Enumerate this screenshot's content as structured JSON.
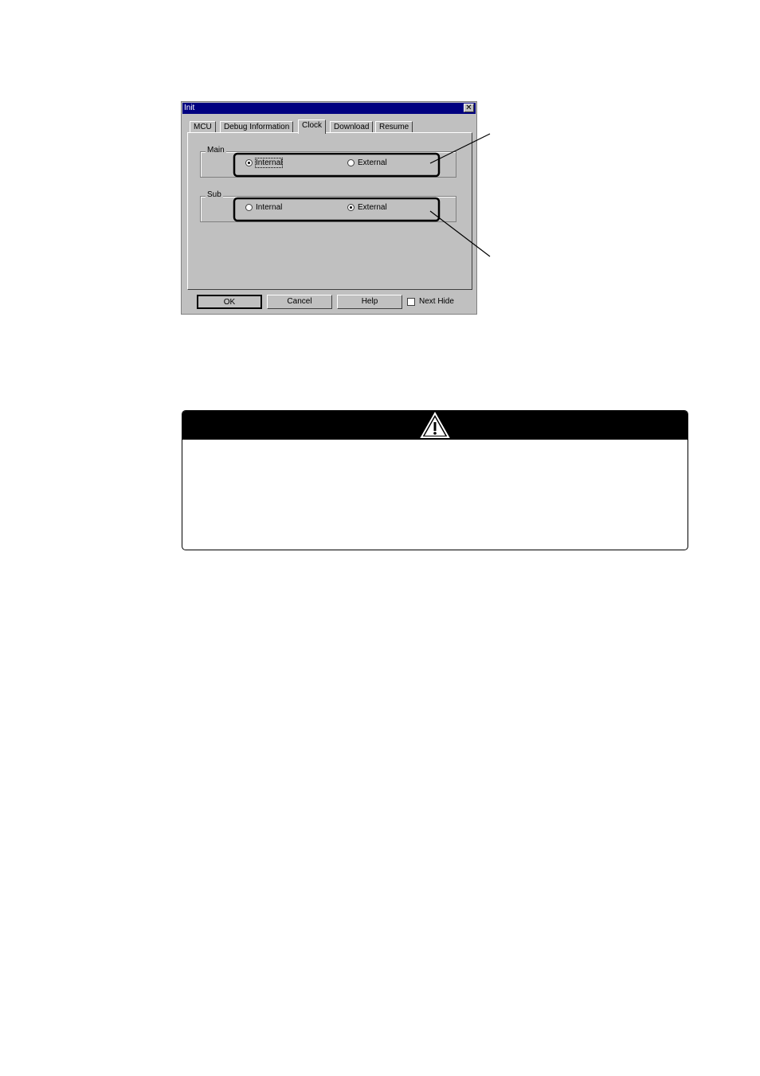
{
  "dialog": {
    "title": "Init",
    "close_glyph": "✕",
    "tabs": [
      {
        "label": "MCU"
      },
      {
        "label": "Debug Information"
      },
      {
        "label": "Clock"
      },
      {
        "label": "Download"
      },
      {
        "label": "Resume"
      }
    ],
    "active_tab": "Clock",
    "groups": {
      "main": {
        "label": "Main",
        "internal": "Internal",
        "external": "External",
        "selected": "Internal"
      },
      "sub": {
        "label": "Sub",
        "internal": "Internal",
        "external": "External",
        "selected": "External"
      }
    },
    "buttons": {
      "ok": "OK",
      "cancel": "Cancel",
      "help": "Help"
    },
    "next_hide": {
      "label": "Next Hide",
      "checked": false
    }
  },
  "warning": {
    "icon": "warning-triangle-icon"
  }
}
